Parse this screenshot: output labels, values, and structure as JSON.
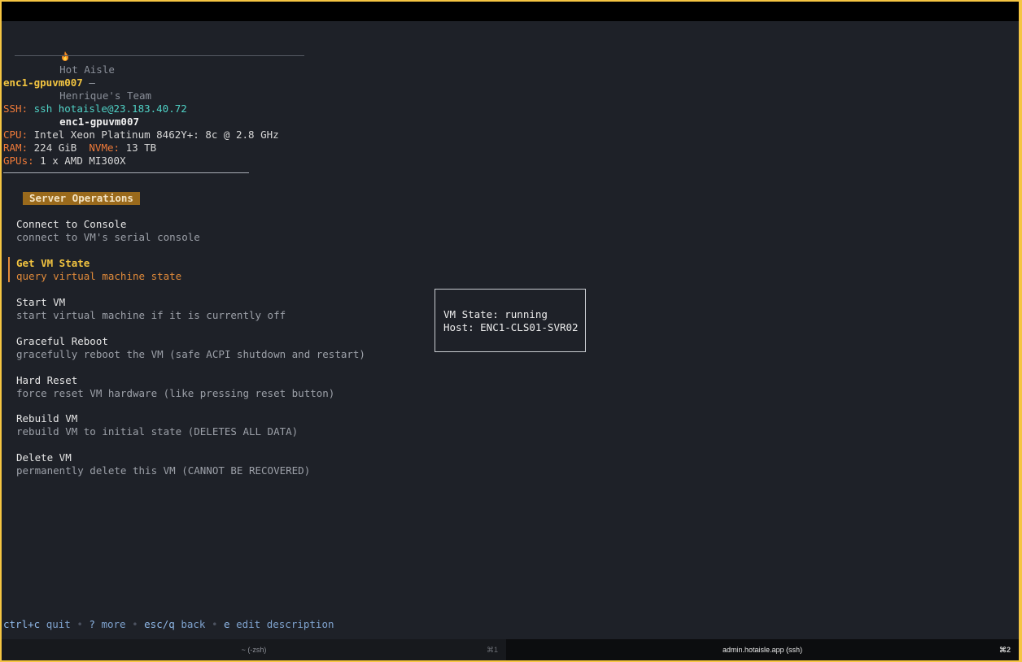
{
  "breadcrumb": {
    "icon": "flame-icon",
    "items": [
      "Hot Aisle",
      "Henrique's Team",
      "enc1-gpuvm007"
    ],
    "separator": "›"
  },
  "server": {
    "hostname": "enc1-gpuvm007",
    "hostname_suffix": " –",
    "ssh_label": "SSH:",
    "ssh_command": "ssh hotaisle@23.183.40.72",
    "cpu_label": "CPU:",
    "cpu_value": "Intel Xeon Platinum 8462Y+: 8c @ 2.8 GHz",
    "ram_label": "RAM:",
    "ram_value": "224 GiB",
    "nvme_label": "NVMe:",
    "nvme_value": "13 TB",
    "gpus_label": "GPUs:",
    "gpus_value": "1 x AMD MI300X"
  },
  "operations": {
    "section_title": "Server Operations",
    "items": [
      {
        "title": "Connect to Console",
        "description": "connect to VM's serial console"
      },
      {
        "title": "Get VM State",
        "description": "query virtual machine state"
      },
      {
        "title": "Start VM",
        "description": "start virtual machine if it is currently off"
      },
      {
        "title": "Graceful Reboot",
        "description": "gracefully reboot the VM (safe ACPI shutdown and restart)"
      },
      {
        "title": "Hard Reset",
        "description": "force reset VM hardware (like pressing reset button)"
      },
      {
        "title": "Rebuild VM",
        "description": "rebuild VM to initial state (DELETES ALL DATA)"
      },
      {
        "title": "Delete VM",
        "description": "permanently delete this VM (CANNOT BE RECOVERED)"
      }
    ],
    "selected_index": 1
  },
  "vm_state_popup": {
    "line1": "VM State: running",
    "line2": "Host: ENC1-CLS01-SVR02"
  },
  "help": {
    "items": [
      {
        "key": "ctrl+c",
        "desc": "quit"
      },
      {
        "key": "?",
        "desc": "more"
      },
      {
        "key": "esc/q",
        "desc": "back"
      },
      {
        "key": "e",
        "desc": "edit description"
      }
    ],
    "separator": "•"
  },
  "tabs": [
    {
      "title": "~ (-zsh)",
      "shortcut": "⌘1",
      "active": false
    },
    {
      "title": "admin.hotaisle.app (ssh)",
      "shortcut": "⌘2",
      "active": true
    }
  ],
  "colors": {
    "window_frame": "#f5c542",
    "terminal_bg": "#1e2128",
    "accent_yellow": "#f2c440",
    "accent_orange": "#ef7a39",
    "ssh_cyan": "#4fd1c5",
    "badge_bg": "#9a6a1c"
  }
}
